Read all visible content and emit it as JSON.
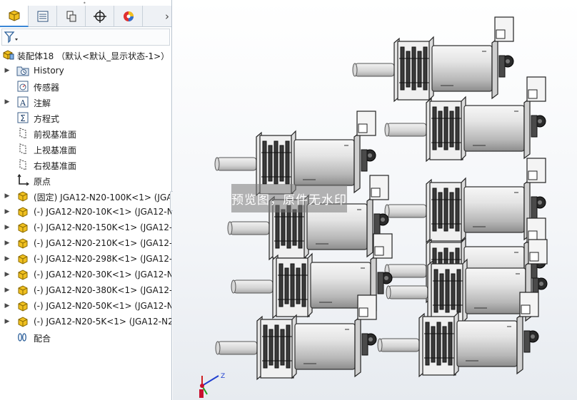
{
  "feature_tree": {
    "tabs": [
      {
        "icon": "feature-manager-icon",
        "active": true
      },
      {
        "icon": "property-manager-icon",
        "active": false
      },
      {
        "icon": "configuration-manager-icon",
        "active": false
      },
      {
        "icon": "dimxpert-icon",
        "active": false
      },
      {
        "icon": "display-manager-icon",
        "active": false
      }
    ],
    "root_label": "装配体18 （默认<默认_显示状态-1>）",
    "items": [
      {
        "label": "History",
        "icon": "history-folder-icon",
        "expandable": true
      },
      {
        "label": "传感器",
        "icon": "sensor-icon",
        "expandable": false
      },
      {
        "label": "注解",
        "icon": "annotation-icon",
        "expandable": true
      },
      {
        "label": "方程式",
        "icon": "equation-icon",
        "expandable": false
      },
      {
        "label": "前视基准面",
        "icon": "plane-icon",
        "expandable": false
      },
      {
        "label": "上视基准面",
        "icon": "plane-icon",
        "expandable": false
      },
      {
        "label": "右视基准面",
        "icon": "plane-icon",
        "expandable": false
      },
      {
        "label": "原点",
        "icon": "origin-icon",
        "expandable": false
      },
      {
        "label": "(固定) JGA12-N20-100K<1> (JGA12",
        "icon": "part-icon",
        "expandable": true
      },
      {
        "label": "(-) JGA12-N20-10K<1> (JGA12-N",
        "icon": "part-icon",
        "expandable": true
      },
      {
        "label": "(-) JGA12-N20-150K<1> (JGA12-I",
        "icon": "part-icon",
        "expandable": true
      },
      {
        "label": "(-) JGA12-N20-210K<1> (JGA12-I",
        "icon": "part-icon",
        "expandable": true
      },
      {
        "label": "(-) JGA12-N20-298K<1> (JGA12-I",
        "icon": "part-icon",
        "expandable": true
      },
      {
        "label": "(-) JGA12-N20-30K<1> (JGA12-N",
        "icon": "part-icon",
        "expandable": true
      },
      {
        "label": "(-) JGA12-N20-380K<1> (JGA12-I",
        "icon": "part-icon",
        "expandable": true
      },
      {
        "label": "(-) JGA12-N20-50K<1> (JGA12-N",
        "icon": "part-icon",
        "expandable": true
      },
      {
        "label": "(-) JGA12-N20-5K<1> (JGA12-N2",
        "icon": "part-icon",
        "expandable": true
      },
      {
        "label": "配合",
        "icon": "mates-icon",
        "expandable": false
      }
    ]
  },
  "viewport": {
    "watermark": "预览图，原件无水印",
    "triad_axis_labels": {
      "x": "X",
      "y": "Y",
      "z": "Z"
    },
    "motor_count": 10,
    "colors": {
      "triad_x": "#d02020",
      "triad_y": "#20a020",
      "triad_z": "#2040d0",
      "part_yellow": "#f0c020"
    }
  }
}
